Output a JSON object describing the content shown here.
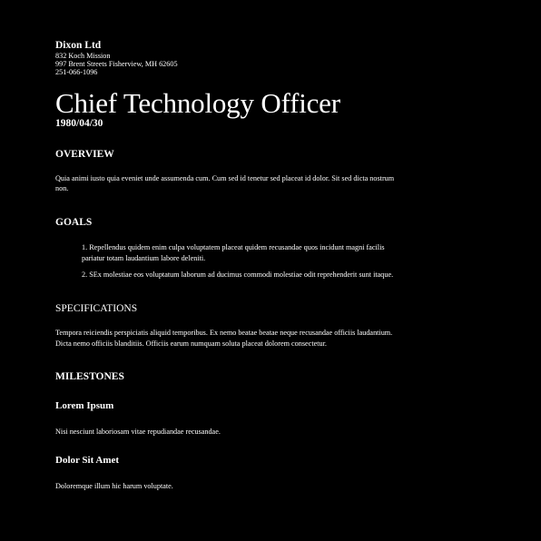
{
  "header": {
    "company": "Dixon Ltd",
    "address_line1": "832 Koch Mission",
    "address_line2": "997 Brent Streets Fisherview, MH 62605",
    "phone": "251-066-1096"
  },
  "title": "Chief Technology Officer",
  "date": "1980/04/30",
  "overview": {
    "heading": "OVERVIEW",
    "text": "Quia animi iusto quia eveniet unde assumenda cum. Cum sed id tenetur sed placeat id dolor. Sit sed dicta nostrum non."
  },
  "goals": {
    "heading": "GOALS",
    "items": [
      "1. Repellendus quidem enim culpa voluptatem placeat quidem recusandae quos incidunt magni facilis pariatur totam laudantium labore deleniti.",
      "2. SEx molestiae eos voluptatum laborum ad ducimus commodi molestiae odit reprehenderit sunt itaque."
    ]
  },
  "specifications": {
    "heading": "SPECIFICATIONS",
    "text": "Tempora reiciendis perspiciatis aliquid temporibus. Ex nemo beatae beatae neque recusandae officiis laudantium. Dicta nemo officiis blanditiis. Officiis earum numquam soluta placeat dolorem consectetur."
  },
  "milestones": {
    "heading": "MILESTONES",
    "items": [
      {
        "title": "Lorem Ipsum",
        "text": "Nisi nesciunt laboriosam vitae repudiandae recusandae."
      },
      {
        "title": "Dolor Sit Amet",
        "text": "Doloremque illum hic harum voluptate."
      }
    ]
  }
}
